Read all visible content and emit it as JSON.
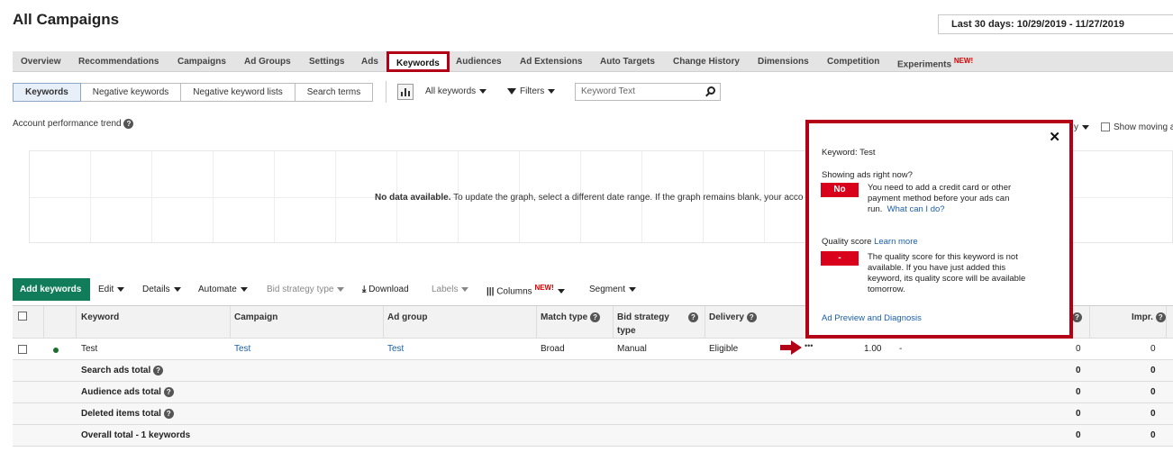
{
  "header": {
    "title": "All Campaigns",
    "date_range": "Last 30 days: 10/29/2019 - 11/27/2019"
  },
  "tabs": [
    {
      "label": "Overview"
    },
    {
      "label": "Recommendations"
    },
    {
      "label": "Campaigns"
    },
    {
      "label": "Ad Groups"
    },
    {
      "label": "Settings"
    },
    {
      "label": "Ads"
    },
    {
      "label": "Keywords",
      "active": true
    },
    {
      "label": "Audiences"
    },
    {
      "label": "Ad Extensions"
    },
    {
      "label": "Auto Targets"
    },
    {
      "label": "Change History"
    },
    {
      "label": "Dimensions"
    },
    {
      "label": "Competition"
    },
    {
      "label": "Experiments",
      "badge": "NEW!"
    }
  ],
  "subtabs": [
    "Keywords",
    "Negative keywords",
    "Negative keyword lists",
    "Search terms"
  ],
  "filters": {
    "scope": "All keywords",
    "filters_label": "Filters",
    "search_placeholder": "Keyword Text"
  },
  "trend": {
    "label": "Account performance trend",
    "nodata_bold": "No data available.",
    "nodata_text": "To update the graph, select a different date range. If the graph remains blank, your acco",
    "partial_y": "y",
    "show_moving": "Show moving a"
  },
  "toolbar": {
    "add": "Add keywords",
    "edit": "Edit",
    "details": "Details",
    "automate": "Automate",
    "bid_strategy_type": "Bid strategy type",
    "download": "Download",
    "labels": "Labels",
    "columns": "Columns",
    "columns_badge": "NEW!",
    "segment": "Segment"
  },
  "table": {
    "headers": {
      "keyword": "Keyword",
      "campaign": "Campaign",
      "ad_group": "Ad group",
      "match_type": "Match type",
      "bid_strategy_1": "Bid strategy",
      "bid_strategy_2": "type",
      "delivery": "Delivery",
      "impr": "Impr."
    },
    "rows": [
      {
        "keyword": "Test",
        "campaign": "Test",
        "ad_group": "Test",
        "match_type": "Broad",
        "bid_strategy": "Manual",
        "delivery": "Eligible",
        "bid": "1.00",
        "dash": "-",
        "col_a": "0",
        "impr": "0"
      }
    ],
    "totals": [
      {
        "label": "Search ads total",
        "col_a": "0",
        "impr": "0"
      },
      {
        "label": "Audience ads total",
        "col_a": "0",
        "impr": "0"
      },
      {
        "label": "Deleted items total",
        "col_a": "0",
        "impr": "0"
      },
      {
        "label": "Overall total - 1 keywords",
        "col_a": "0",
        "impr": "0"
      }
    ]
  },
  "popup": {
    "keyword_line": "Keyword: Test",
    "showing_q": "Showing ads right now?",
    "no_badge": "No",
    "no_reason_1": "You need to add a credit card or other",
    "no_reason_2": "payment method before your ads can",
    "no_reason_3": "run.",
    "what_can_i_do": "What can I do?",
    "qs_label": "Quality score",
    "learn_more": "Learn more",
    "qs_badge": "-",
    "qs_text_1": "The quality score for this keyword is not",
    "qs_text_2": "available. If you have just added this",
    "qs_text_3": "keyword, its quality score will be available",
    "qs_text_4": "tomorrow.",
    "preview": "Ad Preview and Diagnosis"
  },
  "colors": {
    "accent_red": "#b30016",
    "brand_green": "#107c5a",
    "link_blue": "#1a5fa8"
  }
}
